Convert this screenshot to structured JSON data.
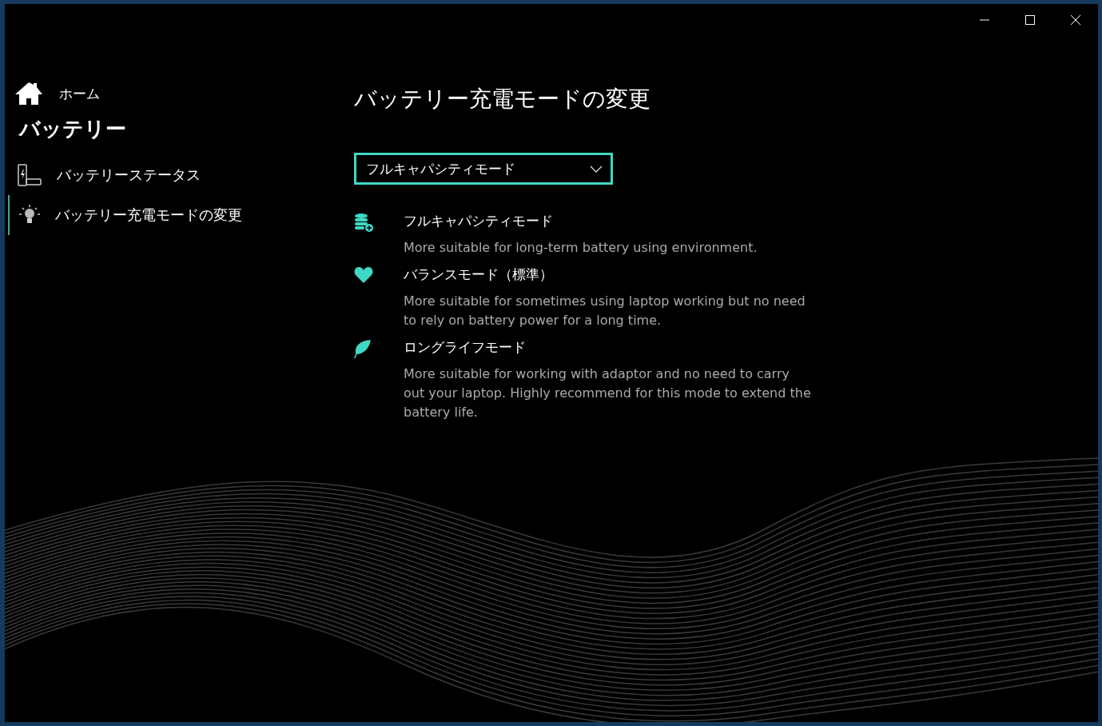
{
  "sidebar": {
    "home": "ホーム",
    "section_title": "バッテリー",
    "items": [
      {
        "label": "バッテリーステータス",
        "kind": "battery",
        "selected": false
      },
      {
        "label": "バッテリー充電モードの変更",
        "kind": "bulb",
        "selected": true
      }
    ]
  },
  "page_title": "バッテリー充電モードの変更",
  "mode_dropdown": {
    "value": "フルキャパシティモード"
  },
  "modes": [
    {
      "kind": "database",
      "name": "フルキャパシティモード",
      "description": "More suitable for long-term battery using environment."
    },
    {
      "kind": "heart",
      "name": "バランスモード（標準）",
      "description": "More suitable for sometimes using laptop working but no need to rely on battery power for a long time."
    },
    {
      "kind": "leaf",
      "name": "ロングライフモード",
      "description": "More suitable for working with adaptor and no need to carry out your laptop. Highly recommend for this mode to extend the battery life."
    }
  ]
}
